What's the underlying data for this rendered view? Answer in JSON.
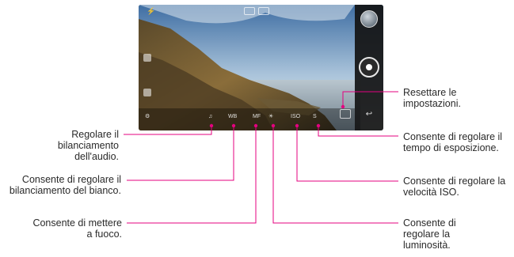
{
  "screen": {
    "top_icons": [
      "flash-icon",
      "settings-icon",
      "manual-mode-icon",
      "grid-icon"
    ],
    "manual_controls": [
      "audio-balance-icon",
      "white-balance-icon",
      "focus-icon",
      "brightness-icon",
      "iso-icon",
      "shutter-speed-icon"
    ]
  },
  "callouts": {
    "audio": "Regolare il bilanciamento dell'audio.",
    "white_balance": "Consente di regolare il bilanciamento del bianco.",
    "focus": "Consente di mettere a fuoco.",
    "reset": "Resettare le impostazioni.",
    "shutter": "Consente di regolare il tempo di esposizione.",
    "iso": "Consente di regolare la velocità ISO.",
    "brightness": "Consente di regolare la luminosità."
  },
  "colors": {
    "line": "#e4007f",
    "label": "#2a2a2a"
  }
}
